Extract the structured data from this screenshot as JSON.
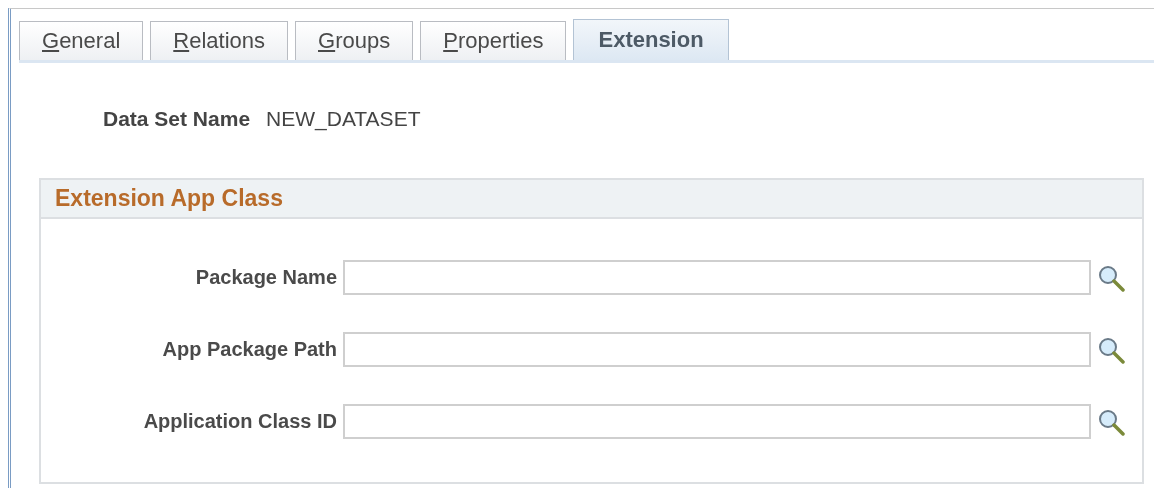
{
  "tabs": [
    {
      "label": "General",
      "selected": false,
      "underline_first": true
    },
    {
      "label": "Relations",
      "selected": false,
      "underline_first": true
    },
    {
      "label": "Groups",
      "selected": false,
      "underline_first": true
    },
    {
      "label": "Properties",
      "selected": false,
      "underline_first": true
    },
    {
      "label": "Extension",
      "selected": true,
      "underline_first": false
    }
  ],
  "data_set": {
    "label": "Data Set Name",
    "value": "NEW_DATASET"
  },
  "group": {
    "title": "Extension App Class",
    "fields": [
      {
        "label": "Package Name"
      },
      {
        "label": "App Package Path"
      },
      {
        "label": "Application Class ID"
      }
    ]
  }
}
